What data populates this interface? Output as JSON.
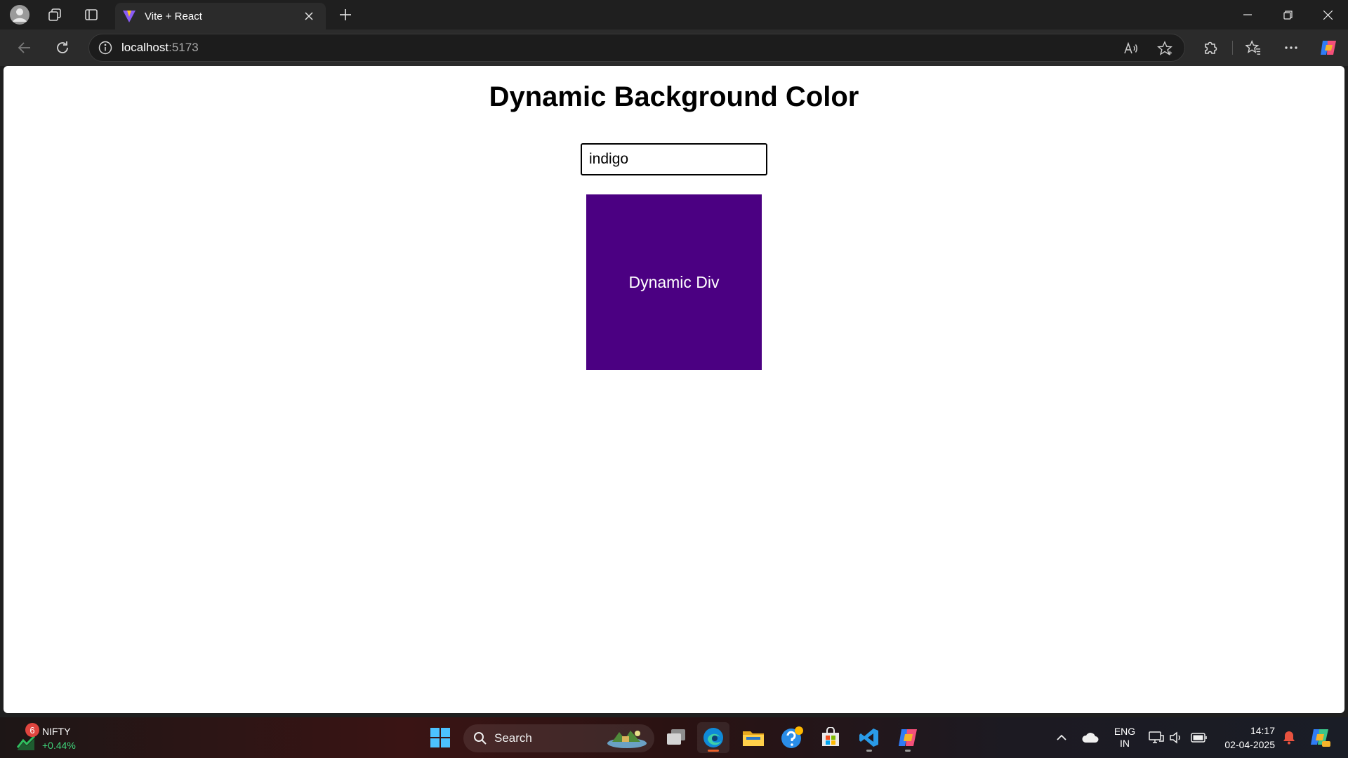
{
  "browser": {
    "tab_title": "Vite + React",
    "address_host": "localhost",
    "address_port": ":5173"
  },
  "page": {
    "title": "Dynamic Background Color",
    "input_value": "indigo",
    "dynamic_div_label": "Dynamic Div",
    "dynamic_div_color": "#4b0082"
  },
  "taskbar": {
    "widget_badge": "6",
    "widget_name": "NIFTY",
    "widget_change": "+0.44%",
    "search_label": "Search",
    "lang_line1": "ENG",
    "lang_line2": "IN",
    "time": "14:17",
    "date": "02-04-2025"
  },
  "colors": {
    "titlebar": "#1f1f1f",
    "toolbar": "#2b2b2b",
    "page_background": "#ffffff",
    "accent_edge": "#e8602a",
    "nifty_change": "#3fd47a"
  },
  "icons": {
    "profile": "profile-avatar-icon",
    "workspaces": "workspaces-icon",
    "vertical_tabs": "vertical-tabs-icon",
    "tab_favicon": "vite-logo-icon",
    "back": "back-arrow-icon",
    "refresh": "refresh-icon",
    "site_info": "info-icon",
    "read_aloud": "read-aloud-icon",
    "favorite": "star-icon",
    "extensions": "puzzle-icon",
    "favorites_list": "favorites-icon",
    "more": "more-icon",
    "copilot": "copilot-icon"
  }
}
